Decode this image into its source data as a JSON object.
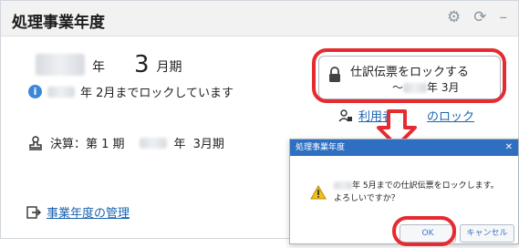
{
  "panel": {
    "title": "処理事業年度",
    "icons": [
      "gear-icon",
      "refresh-icon",
      "minimize-icon"
    ]
  },
  "fiscal": {
    "year_unit": "年",
    "month_value": "3",
    "month_unit": "月期",
    "lock_note": "年 2月までロックしています"
  },
  "settlement": {
    "label": "決算：第 1 期",
    "year_unit": "年",
    "month": "3月期"
  },
  "manage_link": "事業年度の管理",
  "lock_button": {
    "line1": "仕訳伝票をロックする",
    "line2_prefix": "～",
    "line2_suffix": "年 3月"
  },
  "user_lock_link": {
    "part1": "利用者",
    "part2": "のロック"
  },
  "dialog": {
    "title": "処理事業年度",
    "message_line1": "年 5月までの仕訳伝票をロックします。",
    "message_line2": "よろしいですか？",
    "ok_label": "OK",
    "cancel_label": "キャンセル"
  },
  "colors": {
    "highlight": "#e62b30",
    "link": "#1a64b0",
    "dialog_titlebar": "#2f6fc2"
  }
}
